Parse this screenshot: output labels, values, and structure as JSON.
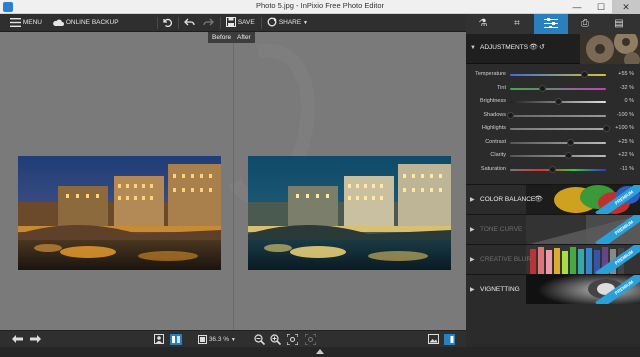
{
  "window": {
    "title": "Photo 5.jpg - InPixio Free Photo Editor",
    "min_glyph": "—",
    "max_glyph": "☐",
    "close_glyph": "✕"
  },
  "toolbar": {
    "menu_label": "MENU",
    "backup_label": "ONLINE BACKUP",
    "save_label": "SAVE",
    "share_label": "SHARE"
  },
  "compare": {
    "before_label": "Before",
    "after_label": "After"
  },
  "bottom": {
    "zoom_value": "36.3 %"
  },
  "panel": {
    "tabs": [
      {
        "name": "flask",
        "glyph": "⚗"
      },
      {
        "name": "crop",
        "glyph": "⌗"
      },
      {
        "name": "adjustments",
        "glyph": "☰"
      },
      {
        "name": "export",
        "glyph": "⎙"
      },
      {
        "name": "layers",
        "glyph": "▤"
      }
    ],
    "adjustments_label": "ADJUSTMENTS",
    "sliders": [
      {
        "label": "Temperature",
        "value_text": "+55 %",
        "level": 0.775,
        "track": "linear-gradient(90deg,#3a6de0,#d6c23a)"
      },
      {
        "label": "Tint",
        "value_text": "-32 %",
        "level": 0.34,
        "track": "linear-gradient(90deg,#38b043,#c040c0)"
      },
      {
        "label": "Brightness",
        "value_text": "0 %",
        "level": 0.5,
        "track": "linear-gradient(90deg,#222,#e0e0e0)"
      },
      {
        "label": "Shadows",
        "value_text": "-100 %",
        "level": 0.0,
        "track": "linear-gradient(90deg,#666,#999)"
      },
      {
        "label": "Highlights",
        "value_text": "+100 %",
        "level": 1.0,
        "track": "linear-gradient(90deg,#777,#aaa)"
      },
      {
        "label": "Contrast",
        "value_text": "+25 %",
        "level": 0.625,
        "track": "linear-gradient(90deg,#555,#bbb)"
      },
      {
        "label": "Clarity",
        "value_text": "+22 %",
        "level": 0.61,
        "track": "linear-gradient(90deg,#555,#bbb)"
      },
      {
        "label": "Saturation",
        "value_text": "-11 %",
        "level": 0.445,
        "track": "linear-gradient(90deg,#777,#d33,#3c3,#33d)"
      }
    ],
    "sections": [
      {
        "label": "COLOR BALANCE",
        "premium": true,
        "dim": false
      },
      {
        "label": "TONE CURVE",
        "premium": true,
        "dim": true
      },
      {
        "label": "CREATIVE BLUR",
        "premium": true,
        "dim": true
      },
      {
        "label": "VIGNETTING",
        "premium": true,
        "dim": false
      }
    ],
    "premium_label": "PREMIUM"
  },
  "colors": {
    "accent": "#2c7fbd",
    "premium_ribbon": "#2a9fd8"
  }
}
